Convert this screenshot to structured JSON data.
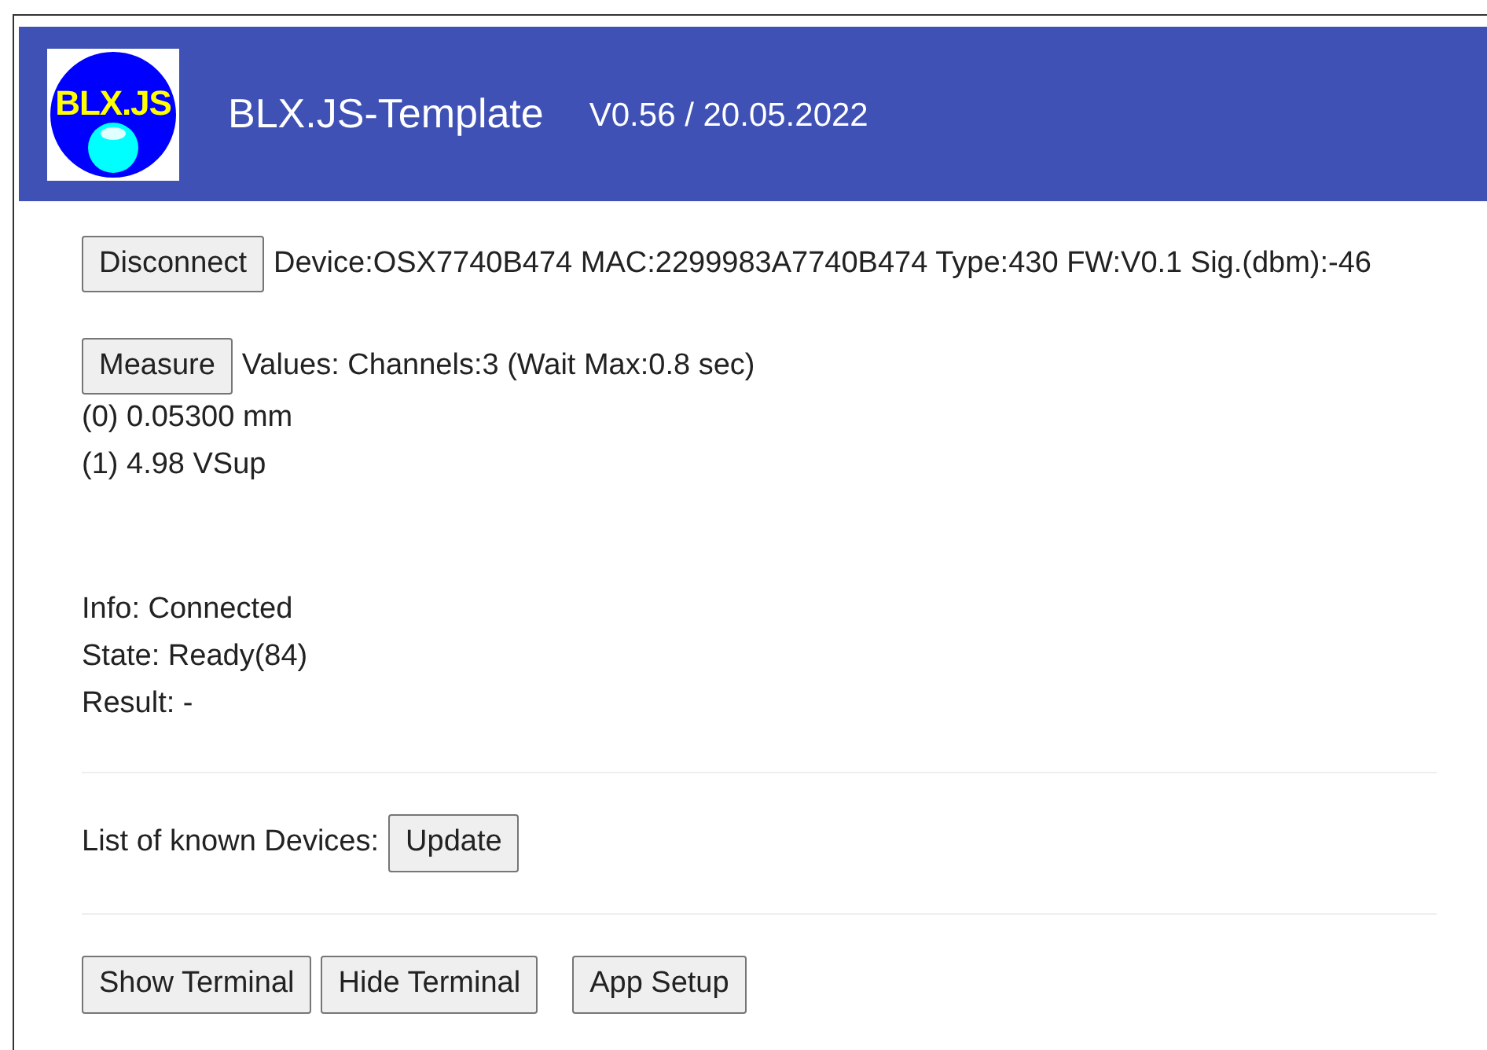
{
  "header": {
    "logo_text": "BLX.JS",
    "title": "BLX.JS-Template",
    "version": "V0.56 / 20.05.2022"
  },
  "connection": {
    "button": "Disconnect",
    "device_info": "Device:OSX7740B474 MAC:2299983A7740B474 Type:430 FW:V0.1 Sig.(dbm):-46"
  },
  "measure": {
    "button": "Measure",
    "summary": "Values: Channels:3 (Wait Max:0.8 sec)",
    "values": [
      "(0) 0.05300 mm",
      "(1) 4.98 VSup"
    ]
  },
  "status": [
    "Info: Connected",
    "State: Ready(84)",
    "Result: -"
  ],
  "devices": {
    "label": "List of known Devices:",
    "button": "Update"
  },
  "footer_button_groups": [
    [
      "Show Terminal",
      "Hide Terminal"
    ],
    [
      "App Setup"
    ]
  ]
}
